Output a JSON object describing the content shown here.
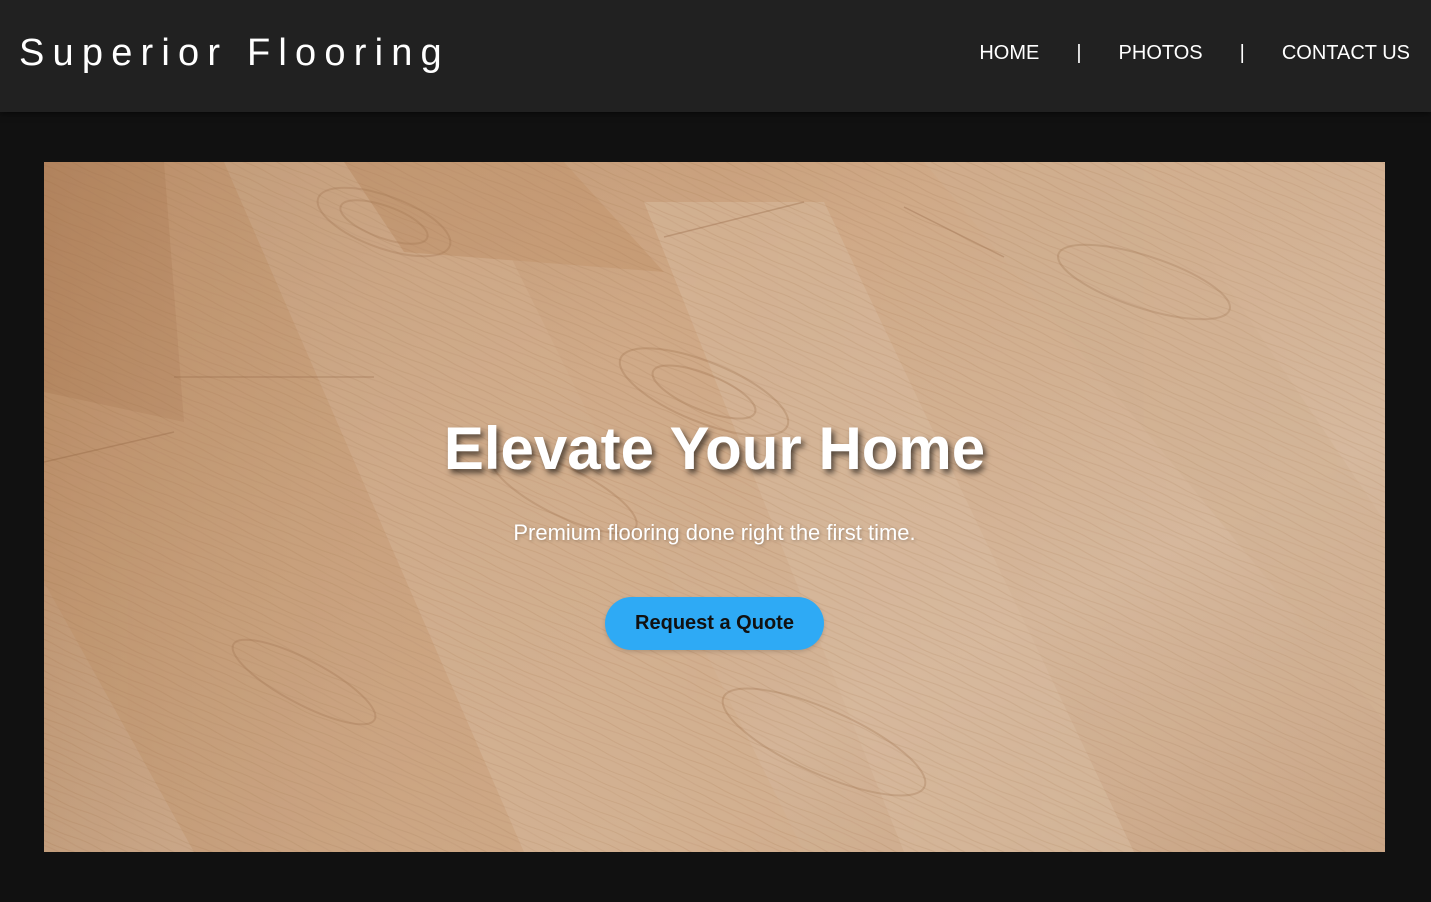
{
  "header": {
    "brand": "Superior Flooring",
    "nav": [
      {
        "label": "HOME"
      },
      {
        "label": "|"
      },
      {
        "label": "PHOTOS"
      },
      {
        "label": "|"
      },
      {
        "label": "CONTACT US"
      }
    ]
  },
  "hero": {
    "image": "hardwood-floor-photo",
    "title": "Elevate Your Home",
    "subtitle": "Premium flooring done right the first time.",
    "cta_label": "Request a Quote"
  },
  "colors": {
    "page_background": "#111111",
    "header_background": "#212121",
    "accent": "#2eaaf5",
    "text": "#ffffff"
  }
}
